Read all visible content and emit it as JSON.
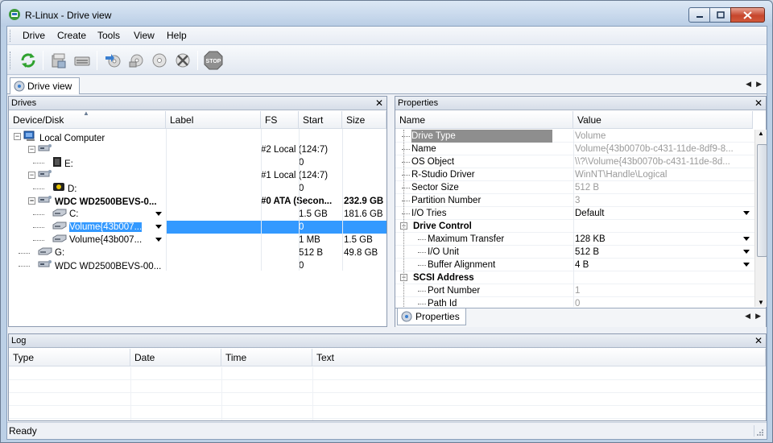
{
  "window": {
    "title": "R-Linux - Drive view"
  },
  "menu": [
    "Drive",
    "Create",
    "Tools",
    "View",
    "Help"
  ],
  "toolbar": {
    "buttons": [
      "refresh-icon",
      "open-drive-files-icon",
      "scan-icon",
      "create-image-icon",
      "open-image-icon",
      "create-region-icon",
      "remove-icon",
      "stop-icon"
    ]
  },
  "doc_tab": {
    "label": "Drive view"
  },
  "drives": {
    "title": "Drives",
    "columns": [
      "Device/Disk",
      "Label",
      "FS",
      "Start",
      "Size"
    ],
    "rows": [
      {
        "device": "Local Computer",
        "label": "",
        "fs": "",
        "start": "",
        "size": "",
        "bold": false,
        "selected": false,
        "dropdown": false
      },
      {
        "device": "",
        "label": "",
        "fs": "#2  Local (124:7)",
        "start": "",
        "size": "",
        "bold": false,
        "selected": false,
        "dropdown": false
      },
      {
        "device": "E:",
        "label": "",
        "fs": "",
        "start": "0",
        "size": "",
        "bold": false,
        "selected": false,
        "dropdown": false
      },
      {
        "device": "",
        "label": "",
        "fs": "#1  Local (124:7)",
        "start": "",
        "size": "",
        "bold": false,
        "selected": false,
        "dropdown": false
      },
      {
        "device": "D:",
        "label": "",
        "fs": "",
        "start": "0",
        "size": "",
        "bold": false,
        "selected": false,
        "dropdown": false
      },
      {
        "device": "WDC WD2500BEVS-0...",
        "label": "",
        "fs": "#0  ATA (Secon...",
        "start": "",
        "size": "232.9 GB",
        "bold": true,
        "selected": false,
        "dropdown": false
      },
      {
        "device": "C:",
        "label": "",
        "fs": "",
        "start": "1.5 GB",
        "size": "181.6 GB",
        "bold": false,
        "selected": false,
        "dropdown": true
      },
      {
        "device": "Volume{43b007...",
        "label": "",
        "fs": "",
        "start": "0",
        "size": "",
        "bold": false,
        "selected": true,
        "dropdown": true
      },
      {
        "device": "Volume{43b007...",
        "label": "",
        "fs": "",
        "start": "1 MB",
        "size": "1.5 GB",
        "bold": false,
        "selected": false,
        "dropdown": true
      },
      {
        "device": "G:",
        "label": "",
        "fs": "",
        "start": "512 B",
        "size": "49.8 GB",
        "bold": false,
        "selected": false,
        "dropdown": false
      },
      {
        "device": "WDC WD2500BEVS-00...",
        "label": "",
        "fs": "",
        "start": "0",
        "size": "",
        "bold": false,
        "selected": false,
        "dropdown": false
      }
    ]
  },
  "properties": {
    "title": "Properties",
    "columns": [
      "Name",
      "Value"
    ],
    "rows": [
      {
        "name": "Drive Type",
        "value": "Volume",
        "level": 1,
        "grey": true,
        "section": false,
        "dropdown": false,
        "highlight": true
      },
      {
        "name": "Name",
        "value": "Volume{43b0070b-c431-11de-8df9-8...",
        "level": 1,
        "grey": true,
        "section": false,
        "dropdown": false,
        "highlight": false
      },
      {
        "name": "OS Object",
        "value": "\\\\?\\Volume{43b0070b-c431-11de-8d...",
        "level": 1,
        "grey": true,
        "section": false,
        "dropdown": false,
        "highlight": false
      },
      {
        "name": "R-Studio Driver",
        "value": "WinNT\\Handle\\Logical",
        "level": 1,
        "grey": true,
        "section": false,
        "dropdown": false,
        "highlight": false
      },
      {
        "name": "Sector Size",
        "value": "512 B",
        "level": 1,
        "grey": true,
        "section": false,
        "dropdown": false,
        "highlight": false
      },
      {
        "name": "Partition Number",
        "value": "3",
        "level": 1,
        "grey": true,
        "section": false,
        "dropdown": false,
        "highlight": false
      },
      {
        "name": "I/O Tries",
        "value": "Default",
        "level": 1,
        "grey": false,
        "section": false,
        "dropdown": true,
        "highlight": false
      },
      {
        "name": "Drive Control",
        "value": "",
        "level": 0,
        "grey": false,
        "section": true,
        "dropdown": false,
        "highlight": false
      },
      {
        "name": "Maximum Transfer",
        "value": "128 KB",
        "level": 2,
        "grey": false,
        "section": false,
        "dropdown": true,
        "highlight": false
      },
      {
        "name": "I/O Unit",
        "value": "512 B",
        "level": 2,
        "grey": false,
        "section": false,
        "dropdown": true,
        "highlight": false
      },
      {
        "name": "Buffer Alignment",
        "value": "4 B",
        "level": 2,
        "grey": false,
        "section": false,
        "dropdown": true,
        "highlight": false
      },
      {
        "name": "SCSI Address",
        "value": "",
        "level": 0,
        "grey": false,
        "section": true,
        "dropdown": false,
        "highlight": false
      },
      {
        "name": "Port Number",
        "value": "1",
        "level": 2,
        "grey": true,
        "section": false,
        "dropdown": false,
        "highlight": false
      },
      {
        "name": "Path Id",
        "value": "0",
        "level": 2,
        "grey": true,
        "section": false,
        "dropdown": false,
        "highlight": false
      }
    ],
    "tab_label": "Properties"
  },
  "log": {
    "title": "Log",
    "columns": [
      "Type",
      "Date",
      "Time",
      "Text"
    ]
  },
  "status": {
    "text": "Ready"
  },
  "colors": {
    "selection": "#3399ff",
    "accent": "#bcd0e6"
  }
}
